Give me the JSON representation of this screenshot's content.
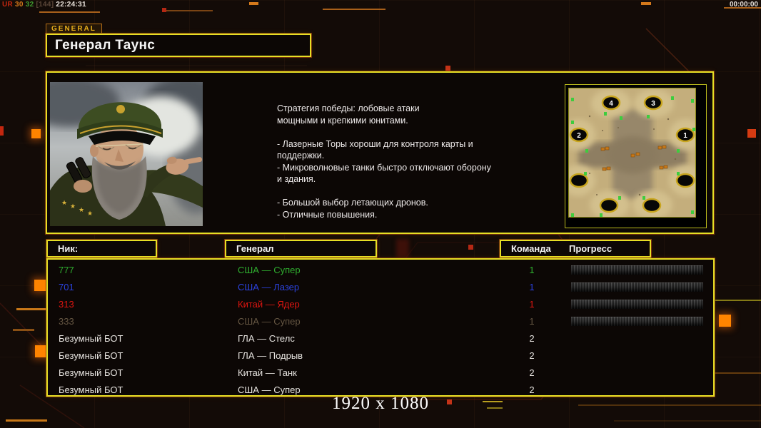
{
  "hud": {
    "fps_parts": [
      {
        "text": "UR",
        "color": "#c3270f"
      },
      {
        "text": "30",
        "color": "#d4791b"
      },
      {
        "text": "32",
        "color": "#3f9b2f"
      },
      {
        "text": "[144]",
        "color": "#5a4638"
      },
      {
        "text": "22:24:31",
        "color": "#e9e2da"
      }
    ],
    "match_timer": "00:00:00"
  },
  "header": {
    "tab_label": "GENERAL",
    "title": "Генерал Таунс"
  },
  "briefing": {
    "strategy_text": "Стратегия победы: лобовые атаки\nмощными и крепкими юнитами.\n\n- Лазерные Торы хороши для контроля карты и\n поддержки.\n- Микроволновые танки быстро отключают оборону\n и здания.\n\n- Большой выбор летающих дронов.\n- Отличные повышения."
  },
  "minimap": {
    "start_positions": [
      "1",
      "2",
      "3",
      "4"
    ]
  },
  "roster": {
    "headers": {
      "nick": "Ник:",
      "general": "Генерал",
      "team": "Команда",
      "progress": "Прогресс"
    },
    "rows": [
      {
        "nick": "777",
        "general": "США — Супер",
        "team": "1",
        "color": "#2fae2f",
        "has_bar": true
      },
      {
        "nick": "701",
        "general": "США — Лазер",
        "team": "1",
        "color": "#2b42dd",
        "has_bar": true
      },
      {
        "nick": "313",
        "general": "Китай — Ядер",
        "team": "1",
        "color": "#dd1510",
        "has_bar": true
      },
      {
        "nick": "333",
        "general": "США — Супер",
        "team": "1",
        "color": "#655642",
        "has_bar": true
      },
      {
        "nick": "Безумный БОТ",
        "general": "ГЛА — Стелс",
        "team": "2",
        "color": "#e7e4e0",
        "has_bar": false
      },
      {
        "nick": "Безумный БОТ",
        "general": "ГЛА — Подрыв",
        "team": "2",
        "color": "#e7e4e0",
        "has_bar": false
      },
      {
        "nick": "Безумный БОТ",
        "general": "Китай — Танк",
        "team": "2",
        "color": "#e7e4e0",
        "has_bar": false
      },
      {
        "nick": "Безумный БОТ",
        "general": "США — Супер",
        "team": "2",
        "color": "#e7e4e0",
        "has_bar": false
      }
    ]
  },
  "footer": {
    "resolution": "1920 x 1080"
  },
  "colors": {
    "panel_border": "#e6df25",
    "accent_orange": "#ff8a00",
    "background": "#130b07",
    "map_sand": "#c4ae7c",
    "map_hole_ring": "#c8a51e",
    "map_resource_green": "#3ecc3e",
    "map_building_orange": "#c87818"
  }
}
